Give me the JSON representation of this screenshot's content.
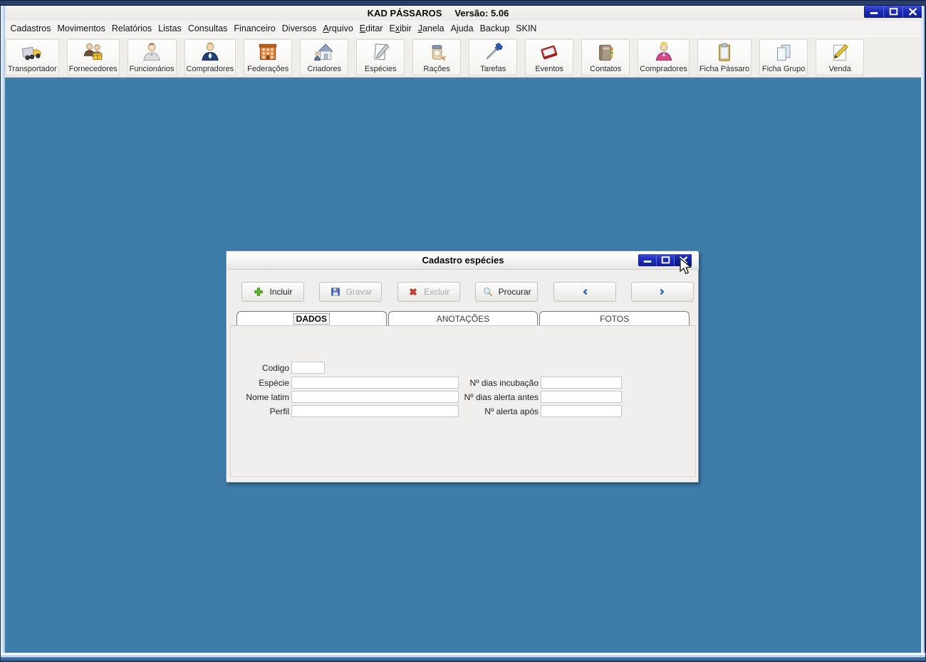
{
  "window": {
    "title": "KAD PÁSSAROS",
    "version_label": "Versão: 5.06",
    "controls": [
      {
        "label": "minimize",
        "icon": "minimize-icon"
      },
      {
        "label": "maximize",
        "icon": "maximize-icon"
      },
      {
        "label": "close",
        "icon": "close-icon"
      }
    ]
  },
  "menu": {
    "items": [
      {
        "label": "Cadastros"
      },
      {
        "label": "Movimentos"
      },
      {
        "label": "Relatórios"
      },
      {
        "label": "Listas"
      },
      {
        "label": "Consultas"
      },
      {
        "label": "Financeiro"
      },
      {
        "label": "Diversos"
      },
      {
        "label": "Arquivo",
        "underline": 0
      },
      {
        "label": "Editar",
        "underline": 0
      },
      {
        "label": "Exibir",
        "underline": 1
      },
      {
        "label": "Janela",
        "underline": 0
      },
      {
        "label": "Ajuda"
      },
      {
        "label": "Backup"
      },
      {
        "label": "SKIN"
      }
    ]
  },
  "toolbar": {
    "buttons": [
      {
        "label": "Transportador",
        "icon": "truck-icon"
      },
      {
        "label": "Fornecedores",
        "icon": "suppliers-icon"
      },
      {
        "label": "Funcionários",
        "icon": "employee-icon"
      },
      {
        "label": "Compradores",
        "icon": "buyer-icon"
      },
      {
        "label": "Federações",
        "icon": "federation-building-icon"
      },
      {
        "label": "Criadores",
        "icon": "breeder-house-icon"
      },
      {
        "label": "Espécies",
        "icon": "species-note-icon"
      },
      {
        "label": "Rações",
        "icon": "feed-jar-icon"
      },
      {
        "label": "Tarefas",
        "icon": "screwdriver-icon"
      },
      {
        "label": "Eventos",
        "icon": "red-book-icon"
      },
      {
        "label": "Contatos",
        "icon": "address-book-icon"
      },
      {
        "label": "Compradores",
        "icon": "buyer-pink-icon"
      },
      {
        "label": "Ficha Pássaro",
        "icon": "clipboard-icon"
      },
      {
        "label": "Ficha Grupo",
        "icon": "sheets-icon"
      },
      {
        "label": "Venda",
        "icon": "pencil-sheet-icon"
      }
    ]
  },
  "dialog": {
    "title": "Cadastro espécies",
    "controls": [
      {
        "label": "minimize",
        "icon": "minimize-icon",
        "hovered": false
      },
      {
        "label": "maximize",
        "icon": "maximize-icon",
        "hovered": false
      },
      {
        "label": "close",
        "icon": "close-icon",
        "hovered": true
      }
    ],
    "buttons": [
      {
        "label": "Incluir",
        "icon": "add-plus-icon",
        "enabled": true
      },
      {
        "label": "Gravar",
        "icon": "save-floppy-icon",
        "enabled": false
      },
      {
        "label": "Excluir",
        "icon": "delete-x-icon",
        "enabled": false
      },
      {
        "label": "Procurar",
        "icon": "search-magnifier-icon",
        "enabled": true
      },
      {
        "label": "",
        "icon": "chevron-left-icon",
        "enabled": true
      },
      {
        "label": "",
        "icon": "chevron-right-icon",
        "enabled": true
      }
    ],
    "tabs": [
      {
        "label": "DADOS",
        "active": true
      },
      {
        "label": "ANOTAÇÕES",
        "active": false
      },
      {
        "label": "FOTOS",
        "active": false
      }
    ],
    "form": {
      "fields": [
        {
          "label": "Codigo",
          "value": ""
        },
        {
          "label": "Espécie",
          "value": ""
        },
        {
          "label": "Nome latim",
          "value": ""
        },
        {
          "label": "Perfil",
          "value": ""
        },
        {
          "label": "Nº dias incubação",
          "value": ""
        },
        {
          "label": "Nº dias alerta antes",
          "value": ""
        },
        {
          "label": "Nº alerta após",
          "value": ""
        }
      ]
    }
  },
  "colors": {
    "desktop_blue": "#3e7caa",
    "titlebar_navy": "#16244e",
    "window_button_blue": "#1c2bb4",
    "disabled_text": "#a8a8a8"
  }
}
